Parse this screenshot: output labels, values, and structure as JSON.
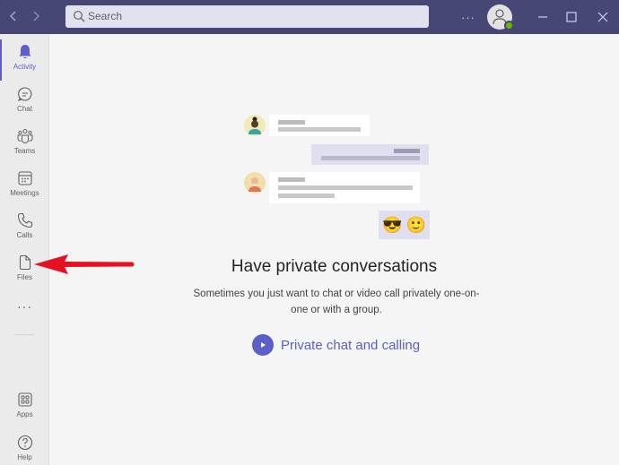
{
  "titlebar": {
    "back_icon": "chevron-left-icon",
    "forward_icon": "chevron-right-icon",
    "search_placeholder": "Search",
    "more_label": "···",
    "minimize_icon": "minimize-icon",
    "maximize_icon": "maximize-icon",
    "close_icon": "close-icon",
    "status_color": "#6bb700"
  },
  "rail": {
    "items": [
      {
        "label": "Activity",
        "icon": "bell-icon",
        "active": true
      },
      {
        "label": "Chat",
        "icon": "chat-icon"
      },
      {
        "label": "Teams",
        "icon": "teams-icon"
      },
      {
        "label": "Meetings",
        "icon": "calendar-icon"
      },
      {
        "label": "Calls",
        "icon": "phone-icon"
      },
      {
        "label": "Files",
        "icon": "file-icon"
      },
      {
        "label": "···",
        "icon": "more-icon"
      },
      {
        "label": "Apps",
        "icon": "apps-icon"
      },
      {
        "label": "Help",
        "icon": "help-icon"
      }
    ]
  },
  "main": {
    "title": "Have private conversations",
    "description": "Sometimes you just want to chat or video call privately one-on-one or with a group.",
    "link_label": "Private chat and calling",
    "emoji_1": "😎",
    "emoji_2": "🙂"
  },
  "colors": {
    "accent": "#5b5fc7",
    "titlebar": "#464775",
    "annotation_arrow": "#e81123"
  }
}
